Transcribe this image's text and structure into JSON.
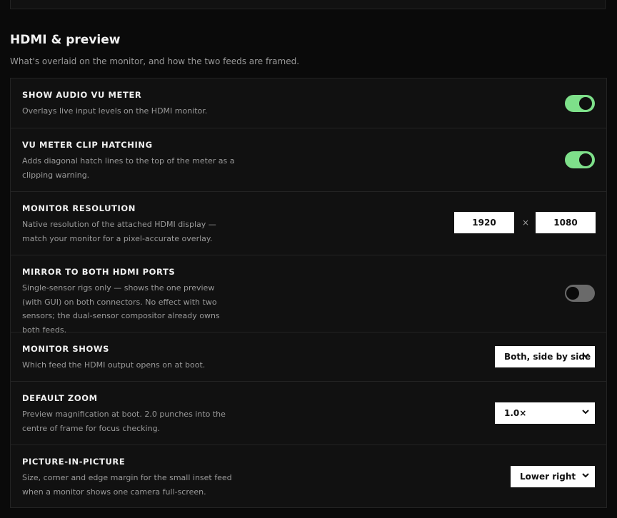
{
  "section": {
    "title": "HDMI & preview",
    "subtitle": "What's overlaid on the monitor, and how the two feeds are framed."
  },
  "settings": {
    "audio_vu": {
      "label": "Show audio VU meter",
      "description": "Overlays live input levels on the HDMI monitor.",
      "enabled": true
    },
    "clip_hatching": {
      "label": "VU meter clip hatching",
      "description": "Adds diagonal hatch lines to the top of the meter as a clipping warning.",
      "enabled": true
    },
    "monitor_resolution": {
      "label": "Monitor resolution",
      "description": "Native resolution of the attached HDMI display — match your monitor for a pixel-accurate overlay.",
      "width": "1920",
      "height": "1080",
      "separator": "×"
    },
    "mirror_hdmi": {
      "label": "Mirror to both HDMI ports",
      "description": "Single-sensor rigs only — shows the one preview (with GUI) on both connectors. No effect with two sensors; the dual-sensor compositor already owns both feeds.",
      "enabled": false
    },
    "monitor_shows": {
      "label": "Monitor shows",
      "description": "Which feed the HDMI output opens on at boot.",
      "value": "Both, side by side"
    },
    "default_zoom": {
      "label": "Default zoom",
      "description": "Preview magnification at boot. 2.0 punches into the centre of frame for focus checking.",
      "value": "1.0×"
    },
    "pip": {
      "label": "Picture-in-picture",
      "description": "Size, corner and edge margin for the small inset feed when a monitor shows one camera full-screen.",
      "value": "Lower right"
    }
  },
  "colors": {
    "toggle_on": "#7ee08a",
    "toggle_off": "#6a6a6a",
    "background": "#0a0a0a",
    "panel": "#111111"
  }
}
